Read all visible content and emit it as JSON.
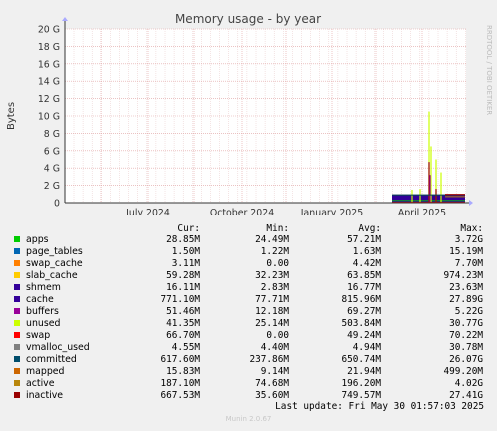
{
  "chart_data": {
    "type": "area",
    "title": "Memory usage - by year",
    "ylabel": "Bytes",
    "side_label": "RRDTOOL / TOBI OETIKER",
    "y_ticks": [
      "0",
      "2 G",
      "4 G",
      "6 G",
      "8 G",
      "10 G",
      "12 G",
      "14 G",
      "16 G",
      "18 G",
      "20 G"
    ],
    "ylim": [
      0,
      20
    ],
    "x_ticks": [
      "July 2024",
      "October 2024",
      "January 2025",
      "April 2025"
    ],
    "grid": true,
    "series_colors": {
      "apps": "#00cc00",
      "page_tables": "#0066b3",
      "swap_cache": "#ff8000",
      "slab_cache": "#ffcc00",
      "shmem": "#330099",
      "cache": "#330099",
      "buffers": "#990099",
      "unused": "#ccff00",
      "swap": "#ff0000",
      "vmalloc_used": "#888888",
      "committed": "#004d4d",
      "mapped": "#cc6600",
      "active": "#b8860b",
      "inactive": "#990000"
    }
  },
  "legend": {
    "headers": [
      "Cur:",
      "Min:",
      "Avg:",
      "Max:"
    ],
    "rows": [
      {
        "name": "apps",
        "color": "#00cc00",
        "cur": "28.85M",
        "min": "24.49M",
        "avg": "57.21M",
        "max": "3.72G"
      },
      {
        "name": "page_tables",
        "color": "#0066b3",
        "cur": "1.50M",
        "min": "1.22M",
        "avg": "1.63M",
        "max": "15.19M"
      },
      {
        "name": "swap_cache",
        "color": "#ff8000",
        "cur": "3.11M",
        "min": "0.00",
        "avg": "4.42M",
        "max": "7.70M"
      },
      {
        "name": "slab_cache",
        "color": "#ffcc00",
        "cur": "59.28M",
        "min": "32.23M",
        "avg": "63.85M",
        "max": "974.23M"
      },
      {
        "name": "shmem",
        "color": "#330099",
        "cur": "16.11M",
        "min": "2.83M",
        "avg": "16.77M",
        "max": "23.63M"
      },
      {
        "name": "cache",
        "color": "#330099",
        "cur": "771.10M",
        "min": "77.71M",
        "avg": "815.96M",
        "max": "27.89G"
      },
      {
        "name": "buffers",
        "color": "#990099",
        "cur": "51.46M",
        "min": "12.18M",
        "avg": "69.27M",
        "max": "5.22G"
      },
      {
        "name": "unused",
        "color": "#ccff00",
        "cur": "41.35M",
        "min": "25.14M",
        "avg": "503.84M",
        "max": "30.77G"
      },
      {
        "name": "swap",
        "color": "#ff0000",
        "cur": "66.70M",
        "min": "0.00",
        "avg": "49.24M",
        "max": "70.22M"
      },
      {
        "name": "vmalloc_used",
        "color": "#808080",
        "cur": "4.55M",
        "min": "4.40M",
        "avg": "4.94M",
        "max": "30.78M"
      },
      {
        "name": "committed",
        "color": "#004d6b",
        "cur": "617.60M",
        "min": "237.86M",
        "avg": "650.74M",
        "max": "26.07G"
      },
      {
        "name": "mapped",
        "color": "#cc6600",
        "cur": "15.83M",
        "min": "9.14M",
        "avg": "21.94M",
        "max": "499.20M"
      },
      {
        "name": "active",
        "color": "#b8860b",
        "cur": "187.10M",
        "min": "74.68M",
        "avg": "196.20M",
        "max": "4.02G"
      },
      {
        "name": "inactive",
        "color": "#990000",
        "cur": "667.53M",
        "min": "35.60M",
        "avg": "749.57M",
        "max": "27.41G"
      }
    ]
  },
  "last_update": "Last update: Fri May 30 01:57:03 2025",
  "footer": "Munin 2.0.67"
}
